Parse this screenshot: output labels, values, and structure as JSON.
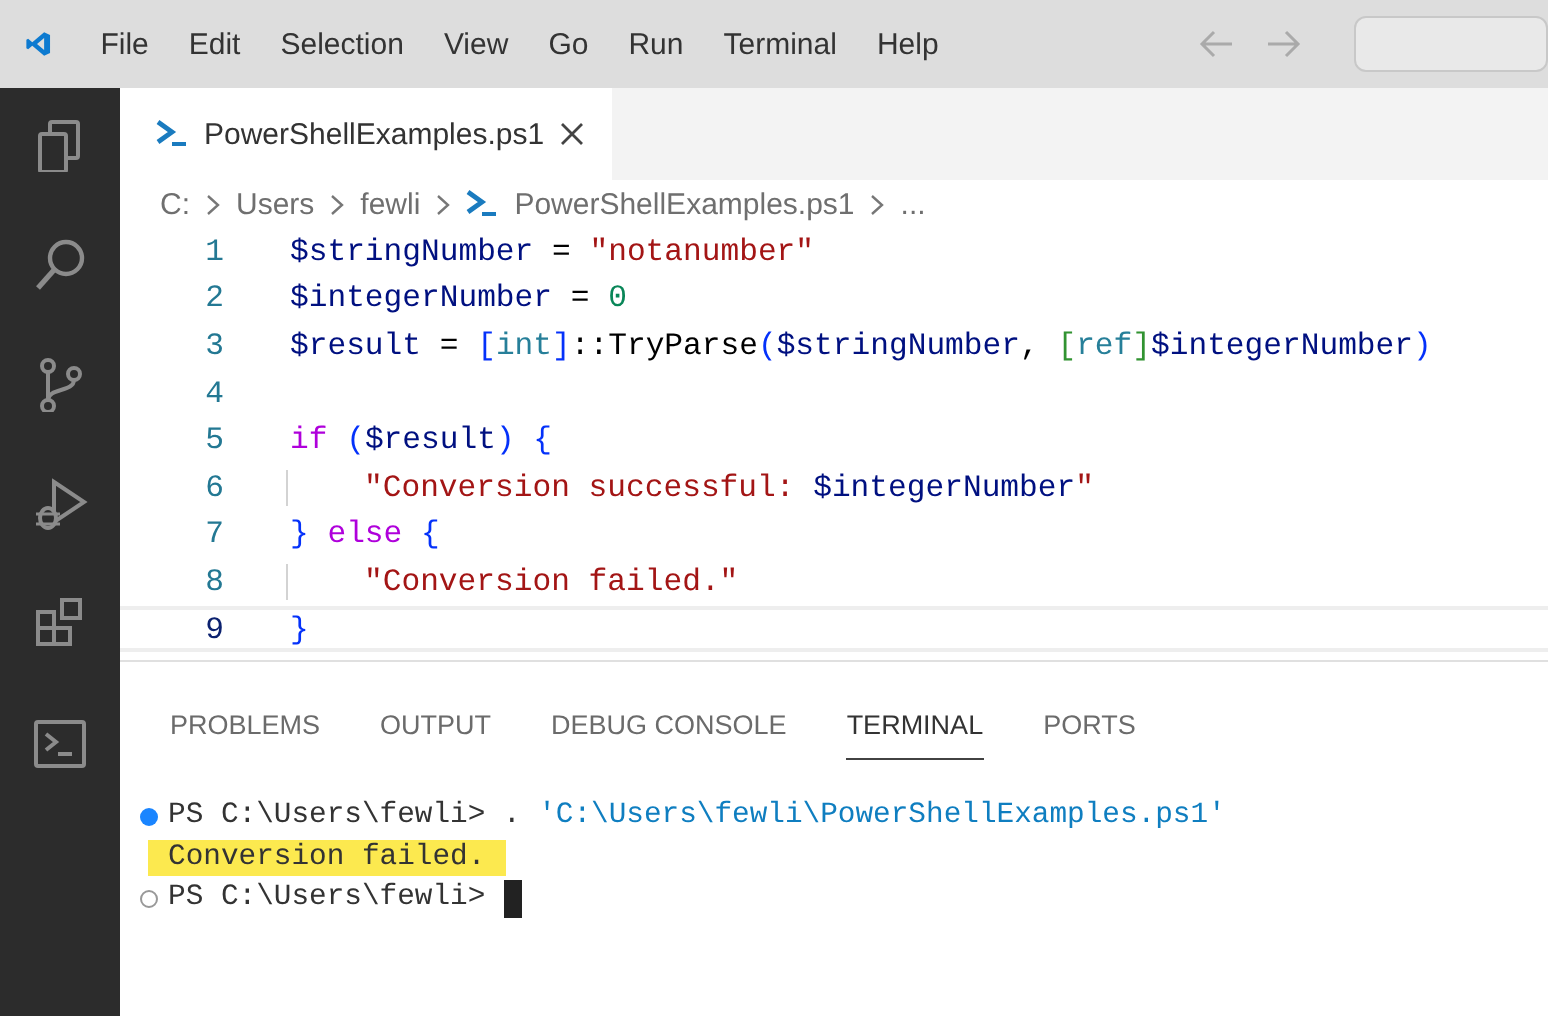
{
  "menu": [
    "File",
    "Edit",
    "Selection",
    "View",
    "Go",
    "Run",
    "Terminal",
    "Help"
  ],
  "activity_bar": [
    {
      "kind": "files",
      "selected": false
    },
    {
      "kind": "search",
      "selected": false
    },
    {
      "kind": "source-control",
      "selected": false
    },
    {
      "kind": "debug",
      "selected": false
    },
    {
      "kind": "extensions",
      "selected": false
    },
    {
      "kind": "terminal",
      "selected": false
    }
  ],
  "tabs": [
    {
      "label": "PowerShellExamples.ps1",
      "selected": true
    }
  ],
  "breadcrumbs": [
    {
      "label": "C:",
      "kind": "folder"
    },
    {
      "label": "Users",
      "kind": "folder"
    },
    {
      "label": "fewli",
      "kind": "folder"
    },
    {
      "label": "PowerShellExamples.ps1",
      "kind": "file"
    },
    {
      "label": "...",
      "kind": "symbol"
    }
  ],
  "code_lines": [
    {
      "number": "1",
      "current": false,
      "tokens": [
        {
          "kind": "var",
          "text": "$stringNumber"
        },
        {
          "kind": "plain",
          "text": " = "
        },
        {
          "kind": "str",
          "text": "\"notanumber\""
        }
      ]
    },
    {
      "number": "2",
      "current": false,
      "tokens": [
        {
          "kind": "var",
          "text": "$integerNumber"
        },
        {
          "kind": "plain",
          "text": " = "
        },
        {
          "kind": "num",
          "text": "0"
        }
      ]
    },
    {
      "number": "3",
      "current": false,
      "tokens": [
        {
          "kind": "var",
          "text": "$result"
        },
        {
          "kind": "plain",
          "text": " = "
        },
        {
          "kind": "bracket",
          "text": "["
        },
        {
          "kind": "type",
          "text": "int"
        },
        {
          "kind": "bracket",
          "text": "]"
        },
        {
          "kind": "plain",
          "text": "::TryParse"
        },
        {
          "kind": "bracket",
          "text": "("
        },
        {
          "kind": "var",
          "text": "$stringNumber"
        },
        {
          "kind": "plain",
          "text": ", "
        },
        {
          "kind": "bracket2",
          "text": "["
        },
        {
          "kind": "type",
          "text": "ref"
        },
        {
          "kind": "bracket2",
          "text": "]"
        },
        {
          "kind": "var",
          "text": "$integerNumber"
        },
        {
          "kind": "bracket",
          "text": ")"
        }
      ]
    },
    {
      "number": "4",
      "current": false
    },
    {
      "number": "5",
      "current": false,
      "tokens": [
        {
          "kind": "kw",
          "text": "if"
        },
        {
          "kind": "bracket",
          "text": " ("
        },
        {
          "kind": "var",
          "text": "$result"
        },
        {
          "kind": "bracket",
          "text": ") {"
        }
      ]
    },
    {
      "number": "6",
      "current": false,
      "indented": true,
      "tokens": [
        {
          "kind": "str",
          "text": "\"Conversion successful: "
        },
        {
          "kind": "var",
          "text": "$integerNumber"
        },
        {
          "kind": "str",
          "text": "\""
        }
      ]
    },
    {
      "number": "7",
      "current": false,
      "tokens": [
        {
          "kind": "bracket",
          "text": "}"
        },
        {
          "kind": "kw",
          "text": " else"
        },
        {
          "kind": "bracket",
          "text": " {"
        }
      ]
    },
    {
      "number": "8",
      "current": false,
      "indented": true,
      "tokens": [
        {
          "kind": "str",
          "text": "\"Conversion failed.\""
        }
      ]
    },
    {
      "number": "9",
      "current": true,
      "tokens": [
        {
          "kind": "bracket",
          "text": "}"
        }
      ]
    }
  ],
  "panel_tabs": [
    {
      "label": "PROBLEMS",
      "selected": false
    },
    {
      "label": "OUTPUT",
      "selected": false
    },
    {
      "label": "DEBUG CONSOLE",
      "selected": false
    },
    {
      "label": "TERMINAL",
      "selected": true
    },
    {
      "label": "PORTS",
      "selected": false
    }
  ],
  "terminal_lines": [
    {
      "kind": "command",
      "finished": true,
      "highlighted": false,
      "cursor": false,
      "segments": [
        {
          "kind": "plain",
          "text": "PS C:\\Users\\fewli> . "
        },
        {
          "kind": "path",
          "text": "'C:\\Users\\fewli\\PowerShellExamples.ps1'"
        }
      ]
    },
    {
      "kind": "output",
      "highlighted": true,
      "cursor": false,
      "segments": [
        {
          "kind": "plain",
          "text": "Conversion failed."
        }
      ]
    },
    {
      "kind": "command",
      "finished": false,
      "highlighted": false,
      "cursor": true,
      "segments": [
        {
          "kind": "plain",
          "text": "PS C:\\Users\\fewli>"
        }
      ]
    }
  ]
}
